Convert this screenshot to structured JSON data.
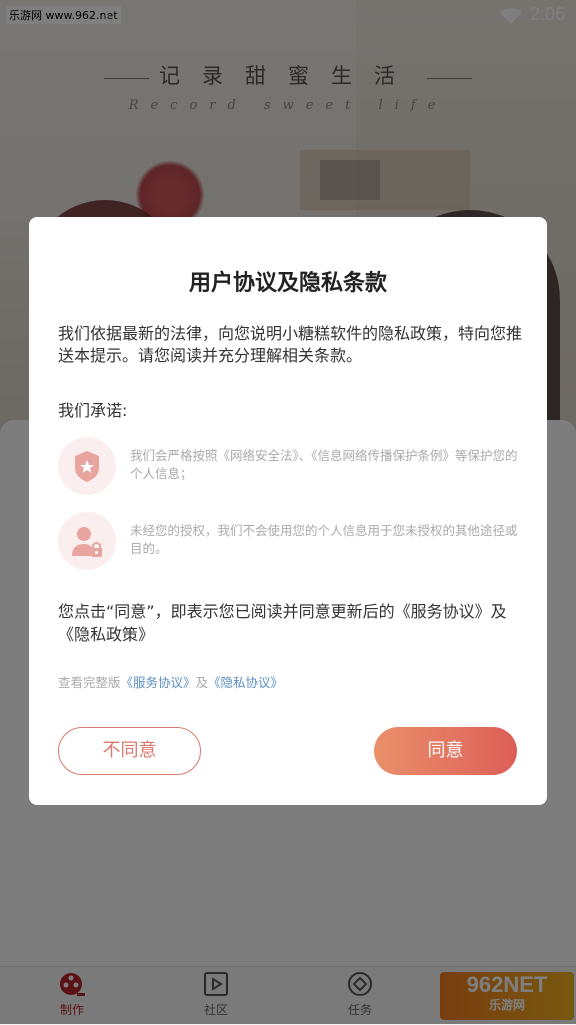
{
  "statusbar": {
    "source_tag": "乐游网 www.962.net",
    "time": "2:06"
  },
  "header": {
    "title_cn": "记录甜蜜生活",
    "title_en": "Record sweet life"
  },
  "dialog": {
    "title": "用户协议及隐私条款",
    "intro": "我们依据最新的法律，向您说明小糖糕软件的隐私政策，特向您推送本提示。请您阅读并充分理解相关条款。",
    "promise_label": "我们承诺:",
    "promises": [
      {
        "icon": "shield-star-icon",
        "text": "我们会严格按照《网络安全法》、《信息网络传播保护条例》等保护您的个人信息；"
      },
      {
        "icon": "user-lock-icon",
        "text": "未经您的授权，我们不会使用您的个人信息用于您未授权的其他途径或目的。"
      }
    ],
    "consent": "您点击“同意”，即表示您已阅读并同意更新后的《服务协议》及《隐私政策》",
    "links_prefix": "查看完整版",
    "link_service": "《服务协议》",
    "links_and": "及",
    "link_privacy": "《隐私协议》",
    "disagree_label": "不同意",
    "agree_label": "同意",
    "accent_color": "#dd5f58"
  },
  "tabbar": {
    "tabs": [
      {
        "label": "制作",
        "icon": "film-reel-icon",
        "active": true
      },
      {
        "label": "社区",
        "icon": "play-icon",
        "active": false
      },
      {
        "label": "任务",
        "icon": "target-icon",
        "active": false
      }
    ]
  },
  "watermark": {
    "top": "962NET",
    "bottom": "乐游网"
  }
}
